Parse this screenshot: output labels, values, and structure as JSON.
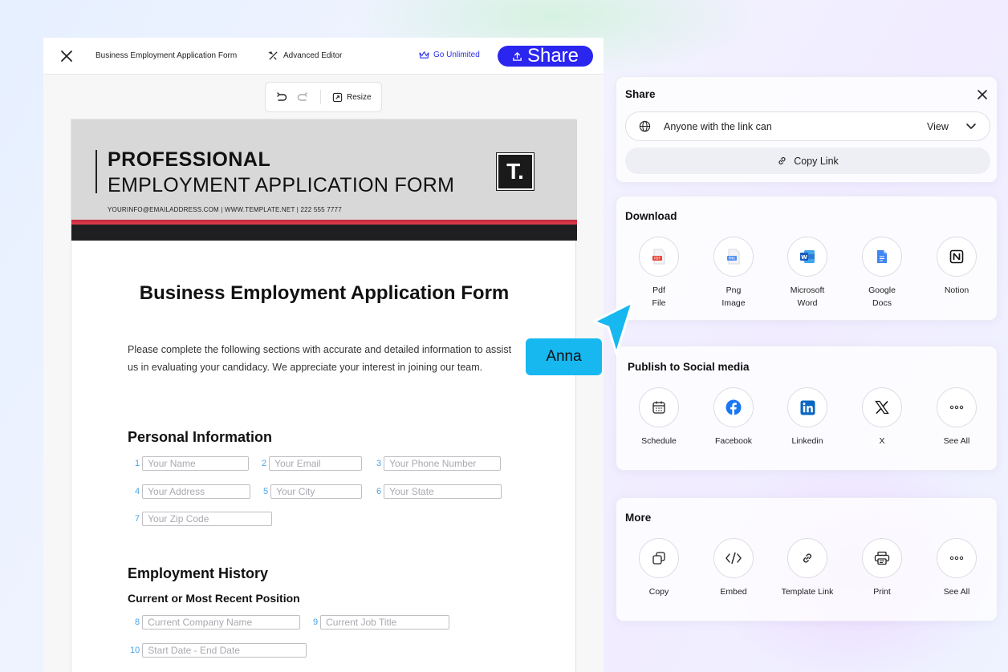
{
  "topbar": {
    "doc_title": "Business Employment Application Form",
    "advanced_editor": "Advanced Editor",
    "go_unlimited": "Go Unlimited",
    "share_label": "Share"
  },
  "toolbar": {
    "resize_label": "Resize"
  },
  "document": {
    "header": {
      "line1": "PROFESSIONAL",
      "line2": "EMPLOYMENT APPLICATION FORM",
      "contact": "YOURINFO@EMAILADDRESS.COM | WWW.TEMPLATE.NET | 222 555 7777",
      "logo": "T."
    },
    "title": "Business Employment Application Form",
    "intro": "Please complete the following sections with accurate and detailed information to assist us in evaluating your candidacy. We appreciate your interest in joining our team.",
    "personal_heading": "Personal Information",
    "fields": [
      {
        "num": "1",
        "placeholder": "Your Name"
      },
      {
        "num": "2",
        "placeholder": "Your Email"
      },
      {
        "num": "3",
        "placeholder": "Your Phone Number"
      },
      {
        "num": "4",
        "placeholder": "Your Address"
      },
      {
        "num": "5",
        "placeholder": "Your City"
      },
      {
        "num": "6",
        "placeholder": "Your State"
      },
      {
        "num": "7",
        "placeholder": "Your Zip Code"
      },
      {
        "num": "8",
        "placeholder": "Current Company Name"
      },
      {
        "num": "9",
        "placeholder": "Current Job Title"
      },
      {
        "num": "10",
        "placeholder": "Start Date - End Date"
      }
    ],
    "employment_heading": "Employment History",
    "current_position_heading": "Current or Most Recent Position"
  },
  "share_panel": {
    "title": "Share",
    "access_text": "Anyone with the link can",
    "access_value": "View",
    "copy_link": "Copy Link"
  },
  "download_panel": {
    "title": "Download",
    "options": [
      {
        "line1": "Pdf",
        "line2": "File",
        "icon": "pdf-icon"
      },
      {
        "line1": "Png",
        "line2": "Image",
        "icon": "png-icon"
      },
      {
        "line1": "Microsoft",
        "line2": "Word",
        "icon": "word-icon"
      },
      {
        "line1": "Google",
        "line2": "Docs",
        "icon": "google-docs-icon"
      },
      {
        "line1": "Notion",
        "line2": "",
        "icon": "notion-icon"
      }
    ]
  },
  "social_panel": {
    "title": "Publish to Social media",
    "options": [
      {
        "label": "Schedule",
        "icon": "calendar-icon"
      },
      {
        "label": "Facebook",
        "icon": "facebook-icon"
      },
      {
        "label": "Linkedin",
        "icon": "linkedin-icon"
      },
      {
        "label": "X",
        "icon": "x-icon"
      },
      {
        "label": "See All",
        "icon": "more-icon"
      }
    ]
  },
  "more_panel": {
    "title": "More",
    "options": [
      {
        "label": "Copy",
        "icon": "copy-icon"
      },
      {
        "label": "Embed",
        "icon": "code-icon"
      },
      {
        "label": "Template Link",
        "icon": "link-icon"
      },
      {
        "label": "Print",
        "icon": "printer-icon"
      },
      {
        "label": "See All",
        "icon": "more-icon"
      }
    ]
  },
  "cursor_tag": "Anna",
  "colors": {
    "primary": "#2b25f0",
    "accent_blue": "#17b8f0",
    "header_red": "#c2293a",
    "field_number": "#4aa5e8"
  }
}
